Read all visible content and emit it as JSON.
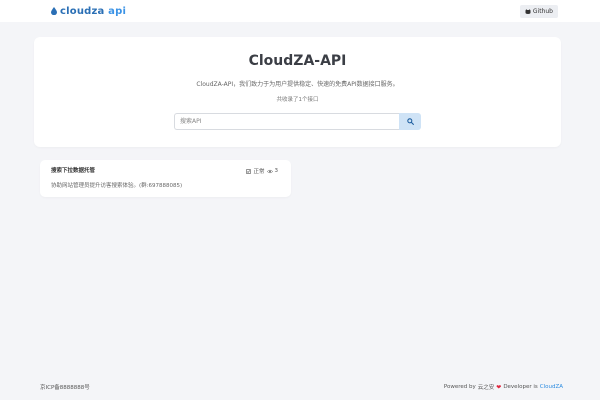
{
  "header": {
    "brand_prefix": "cloudza",
    "brand_suffix": " api",
    "github_label": "Github"
  },
  "hero": {
    "title": "CloudZA-API",
    "description": "CloudZA-API，我们致力于为用户提供稳定、快速的免费API数据接口服务。",
    "count_text": "共收录了1个接口",
    "search_placeholder": "搜索API"
  },
  "api_list": [
    {
      "name": "搜索下拉数据托管",
      "status": "正常",
      "views": "3",
      "description": "协助网站管理员提升访客搜索体验。(群:697888085)"
    }
  ],
  "footer": {
    "icp": "京ICP备8888888号",
    "powered_by": "Powered by",
    "author": "云之安",
    "developer_label": "Developer is",
    "developer_link": "CloudZA"
  },
  "colors": {
    "brand": "#2a6fb5",
    "accent": "#3b93e6",
    "search_button": "#cfe3f6",
    "heart": "#e0243c",
    "link": "#2b8be0"
  }
}
